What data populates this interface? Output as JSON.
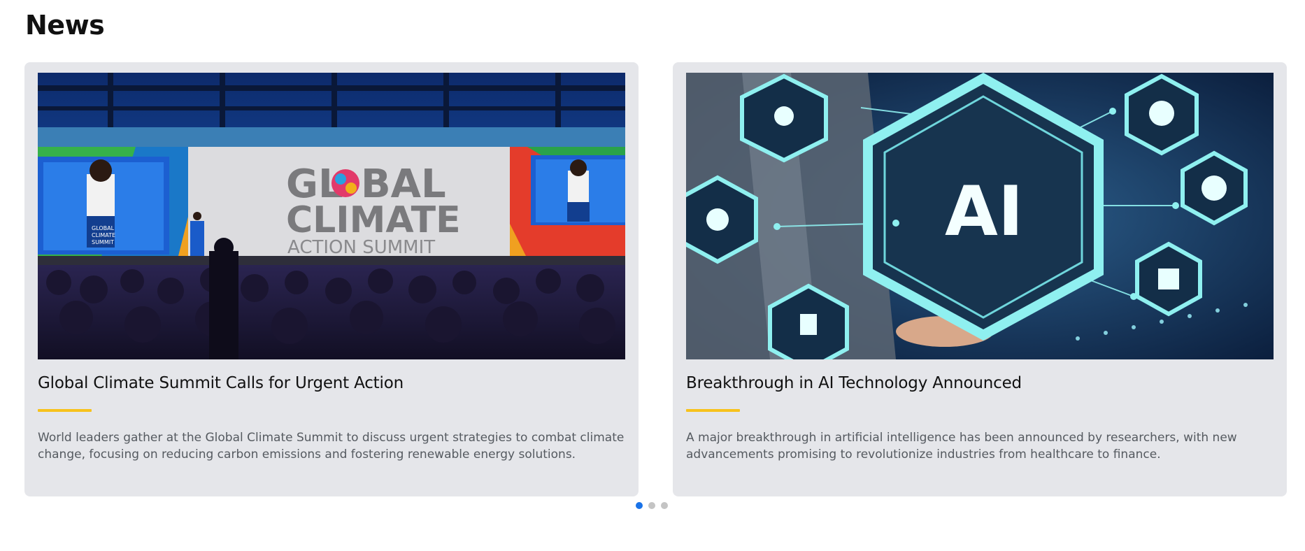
{
  "section": {
    "title": "News"
  },
  "articles": [
    {
      "title": "Global Climate Summit Calls for Urgent Action",
      "description": "World leaders gather at the Global Climate Summit to discuss urgent strategies to combat climate change, focusing on reducing carbon emissions and fostering renewable energy solutions.",
      "image": {
        "icon": "conference-stage-photo",
        "banner_lines": [
          "GL",
          "BAL",
          "CLIMATE",
          "ACTION SUMMIT"
        ],
        "screen_text": [
          "GLOBAL",
          "CLIMATE",
          "SUMMIT"
        ]
      }
    },
    {
      "title": "Breakthrough in AI Technology Announced",
      "description": "A major breakthrough in artificial intelligence has been announced by researchers, with new advancements promising to revolutionize industries from healthcare to finance.",
      "image": {
        "icon": "ai-hexagon-photo",
        "center_text": "AI"
      }
    }
  ],
  "carousel": {
    "total": 3,
    "active": 1
  },
  "colors": {
    "accent": "#f7c21c",
    "card_bg": "#e5e6ea",
    "dot_active": "#1a73e8",
    "dot_inactive": "#c4c4c4"
  }
}
